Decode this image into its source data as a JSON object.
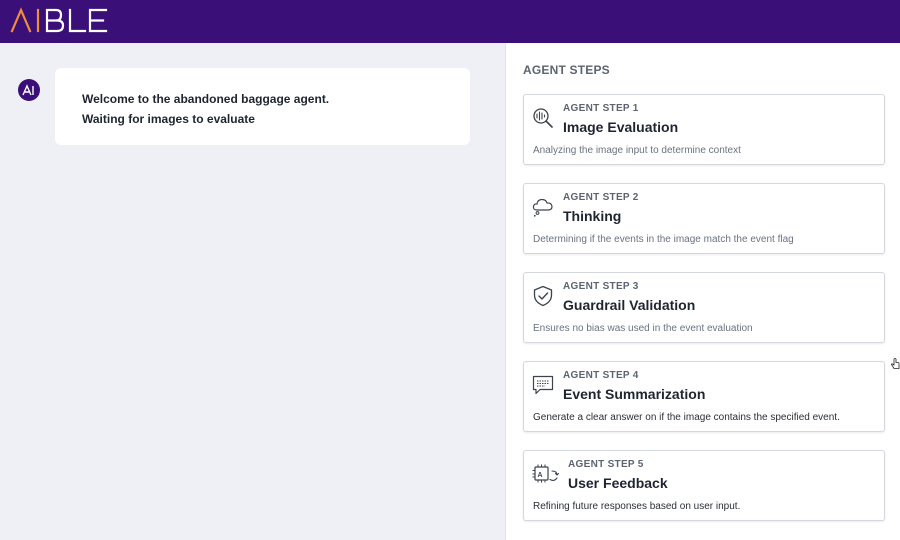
{
  "header": {
    "brand": "AIBLE",
    "brand_colors": {
      "ai": "#f28c38",
      "ble": "#ffffff"
    },
    "bar_color": "#3a1078"
  },
  "chat": {
    "avatar_icon": "aible-avatar-icon",
    "message_lines": [
      "Welcome to the abandoned baggage agent.",
      "Waiting for images to evaluate"
    ]
  },
  "agent_steps": {
    "heading": "AGENT STEPS",
    "steps": [
      {
        "label": "AGENT STEP 1",
        "title": "Image Evaluation",
        "description": "Analyzing the image input to determine context",
        "icon": "image-search-icon"
      },
      {
        "label": "AGENT STEP 2",
        "title": "Thinking",
        "description": "Determining if the events in the image match the event flag",
        "icon": "thought-cloud-icon"
      },
      {
        "label": "AGENT STEP 3",
        "title": "Guardrail Validation",
        "description": "Ensures no bias was used in the event evaluation",
        "icon": "shield-check-icon"
      },
      {
        "label": "AGENT STEP 4",
        "title": "Event Summarization",
        "description": "Generate a clear answer on if the image contains the specified event.",
        "icon": "message-lines-icon"
      },
      {
        "label": "AGENT STEP 5",
        "title": "User Feedback",
        "description": "Refining future responses based on user input.",
        "icon": "ai-chip-feedback-icon"
      }
    ]
  }
}
